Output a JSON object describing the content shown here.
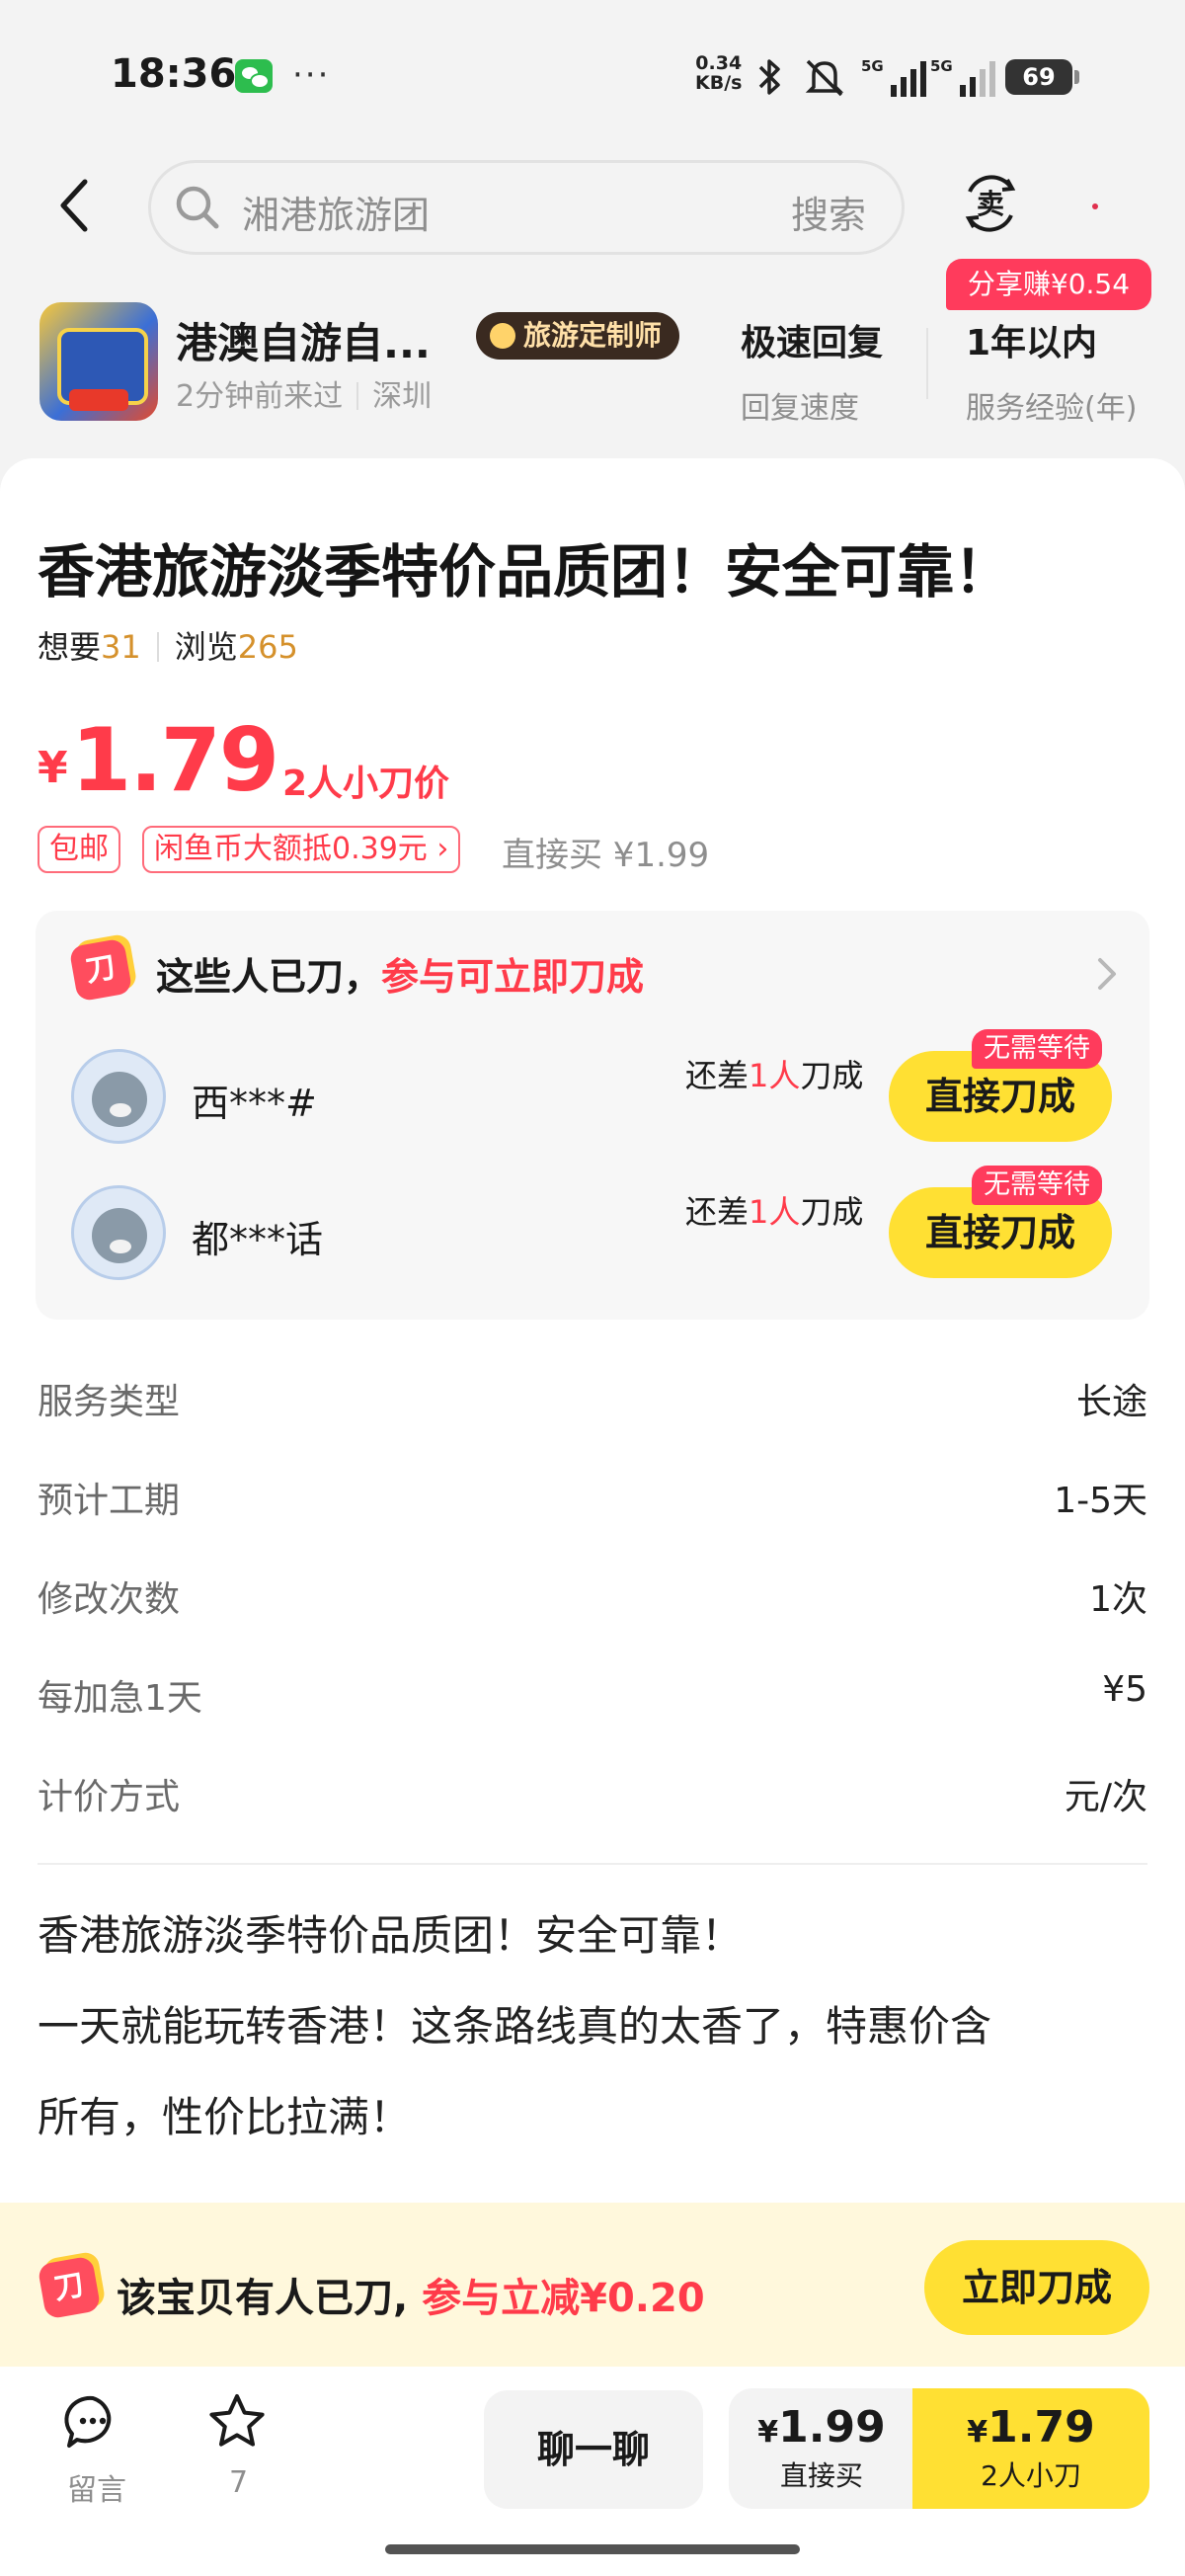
{
  "status_bar": {
    "time": "18:36",
    "dots": "···",
    "net_speed_value": "0.34",
    "net_speed_unit": "KB/s",
    "signal_label": "5G",
    "battery": "69"
  },
  "header": {
    "search_placeholder": "湘港旅游团",
    "search_button": "搜索",
    "sell_label": "卖",
    "share_badge": "分享赚¥0.54"
  },
  "seller": {
    "name": "港澳自游自...",
    "badge": "旅游定制师",
    "last_seen": "2分钟前来过",
    "location": "深圳",
    "stats": [
      {
        "value": "极速回复",
        "label": "回复速度"
      },
      {
        "value": "1年以内",
        "label": "服务经验(年)"
      }
    ]
  },
  "product": {
    "title": "香港旅游淡季特价品质团！安全可靠！",
    "want_label": "想要",
    "want_count": "31",
    "view_label": "浏览",
    "view_count": "265",
    "price_symbol": "¥",
    "price": "1.79",
    "price_tag": "2人小刀价",
    "chips": [
      "包邮",
      "闲鱼币大额抵0.39元 ›"
    ],
    "direct_buy": "直接买 ¥1.99"
  },
  "bargain": {
    "icon_label": "刀",
    "head": "这些人已刀，",
    "head_highlight": "参与可立即刀成",
    "members": [
      {
        "name": "西***#",
        "need_prefix": "还差",
        "need_count": "1人",
        "need_suffix": "刀成",
        "button": "直接刀成",
        "badge": "无需等待"
      },
      {
        "name": "都***话",
        "need_prefix": "还差",
        "need_count": "1人",
        "need_suffix": "刀成",
        "button": "直接刀成",
        "badge": "无需等待"
      }
    ]
  },
  "attributes": [
    {
      "label": "服务类型",
      "value": "长途"
    },
    {
      "label": "预计工期",
      "value": "1-5天"
    },
    {
      "label": "修改次数",
      "value": "1次"
    },
    {
      "label": "每加急1天",
      "value": "¥5"
    },
    {
      "label": "计价方式",
      "value": "元/次"
    }
  ],
  "description": [
    "香港旅游淡季特价品质团！安全可靠！",
    "一天就能玩转香港！这条路线真的太香了，特惠价含",
    "所有，性价比拉满！"
  ],
  "promo": {
    "icon_label": "刀",
    "text": "该宝贝有人已刀,",
    "highlight": "参与立减¥0.20",
    "button": "立即刀成"
  },
  "actions": {
    "message_label": "留言",
    "favorite_count": "7",
    "chat_button": "聊一聊",
    "direct": {
      "symbol": "¥",
      "price": "1.99",
      "label": "直接买"
    },
    "cut": {
      "symbol": "¥",
      "price": "1.79",
      "label": "2人小刀"
    }
  },
  "colors": {
    "accent_yellow": "#ffe033",
    "price_red": "#ff3b4a",
    "badge_pink": "#ff3b5c",
    "count_orange": "#d5912c"
  },
  "icons": [
    "wechat-icon",
    "bluetooth-icon",
    "mute-icon",
    "signal-icon",
    "battery-icon",
    "back-icon",
    "search-icon",
    "sell-icon",
    "chevron-right-icon",
    "message-icon",
    "star-icon"
  ]
}
